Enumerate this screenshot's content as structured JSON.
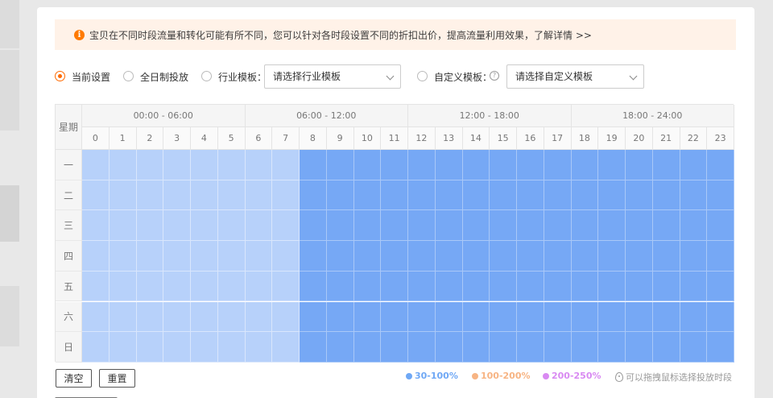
{
  "notice": {
    "icon": "info-icon",
    "text": "宝贝在不同时段流量和转化可能有所不同，您可以针对各时段设置不同的折扣出价，提高流量利用效果，了解详情 >>"
  },
  "options": {
    "current": "当前设置",
    "all_day": "全日制投放",
    "industry_label": "行业模板：",
    "industry_placeholder": "请选择行业模板",
    "custom_label": "自定义模板：",
    "custom_placeholder": "请选择自定义模板",
    "selected": "current"
  },
  "schedule": {
    "weekday_header": "星期",
    "periods": [
      "00:00 - 06:00",
      "06:00 - 12:00",
      "12:00 - 18:00",
      "18:00 - 24:00"
    ],
    "hours": [
      "0",
      "1",
      "2",
      "3",
      "4",
      "5",
      "6",
      "7",
      "8",
      "9",
      "10",
      "11",
      "12",
      "13",
      "14",
      "15",
      "16",
      "17",
      "18",
      "19",
      "20",
      "21",
      "22",
      "23"
    ],
    "days": [
      "一",
      "二",
      "三",
      "四",
      "五",
      "六",
      "日"
    ],
    "levels": {
      "一": [
        "low",
        "low",
        "low",
        "low",
        "low",
        "low",
        "low",
        "low",
        "high",
        "high",
        "high",
        "high",
        "high",
        "high",
        "high",
        "high",
        "high",
        "high",
        "high",
        "high",
        "high",
        "high",
        "high",
        "high"
      ],
      "二": [
        "low",
        "low",
        "low",
        "low",
        "low",
        "low",
        "low",
        "low",
        "high",
        "high",
        "high",
        "high",
        "high",
        "high",
        "high",
        "high",
        "high",
        "high",
        "high",
        "high",
        "high",
        "high",
        "high",
        "high"
      ],
      "三": [
        "low",
        "low",
        "low",
        "low",
        "low",
        "low",
        "low",
        "low",
        "high",
        "high",
        "high",
        "high",
        "high",
        "high",
        "high",
        "high",
        "high",
        "high",
        "high",
        "high",
        "high",
        "high",
        "high",
        "high"
      ],
      "四": [
        "low",
        "low",
        "low",
        "low",
        "low",
        "low",
        "low",
        "low",
        "high",
        "high",
        "high",
        "high",
        "high",
        "high",
        "high",
        "high",
        "high",
        "high",
        "high",
        "high",
        "high",
        "high",
        "high",
        "high"
      ],
      "五": [
        "low",
        "low",
        "low",
        "low",
        "low",
        "low",
        "low",
        "low",
        "high",
        "high",
        "high",
        "high",
        "high",
        "high",
        "high",
        "high",
        "high",
        "high",
        "high",
        "high",
        "high",
        "high",
        "high",
        "high"
      ],
      "六": [
        "low",
        "low",
        "low",
        "low",
        "low",
        "low",
        "low",
        "low",
        "high",
        "high",
        "high",
        "high",
        "high",
        "high",
        "high",
        "high",
        "high",
        "high",
        "high",
        "high",
        "high",
        "high",
        "high",
        "high"
      ],
      "日": [
        "low",
        "low",
        "low",
        "low",
        "low",
        "low",
        "low",
        "low",
        "high",
        "high",
        "high",
        "high",
        "high",
        "high",
        "high",
        "high",
        "high",
        "high",
        "high",
        "high",
        "high",
        "high",
        "high",
        "high"
      ]
    }
  },
  "buttons": {
    "clear": "清空",
    "reset": "重置"
  },
  "legend": [
    {
      "label": "30-100%",
      "color": "#6fa8f5"
    },
    {
      "label": "100-200%",
      "color": "#f7b483"
    },
    {
      "label": "200-250%",
      "color": "#d98af2"
    }
  ],
  "tip": "可以拖拽鼠标选择投放时段",
  "colors": {
    "accent": "#ff6a00",
    "low": "#b7d1fa",
    "high": "#76a8f5"
  }
}
